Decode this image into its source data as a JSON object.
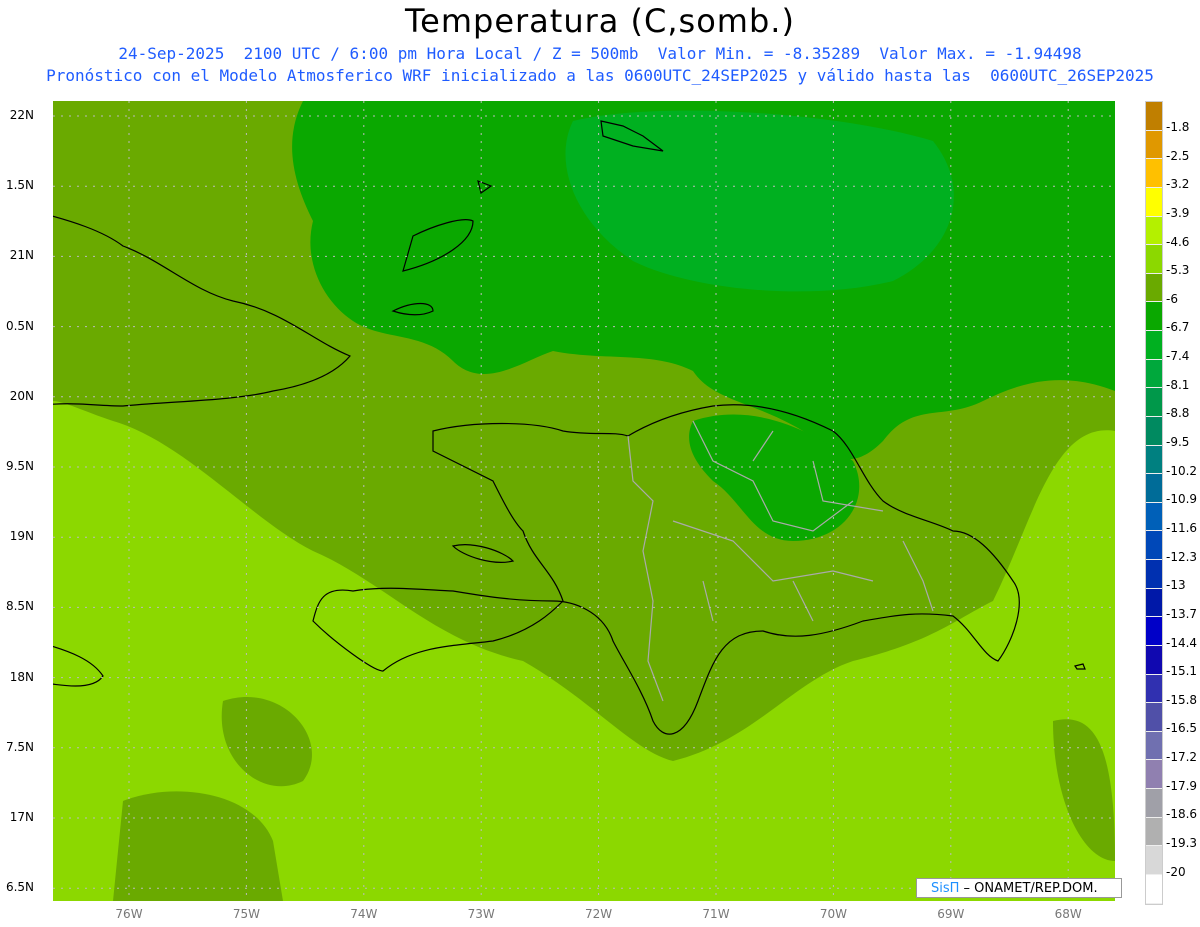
{
  "header": {
    "title": "Temperatura (C,somb.)",
    "line1": "24-Sep-2025  2100 UTC / 6:00 pm Hora Local / Z = 500mb  Valor Min. = -8.35289  Valor Max. = -1.94498",
    "line2": "Pronóstico con el Modelo Atmosferico WRF inicializado a las 0600UTC_24SEP2025 y válido hasta las  0600UTC_26SEP2025"
  },
  "axes": {
    "lat_labels": [
      "22N",
      "1.5N",
      "21N",
      "0.5N",
      "20N",
      "9.5N",
      "19N",
      "8.5N",
      "18N",
      "7.5N",
      "17N",
      "6.5N"
    ],
    "lon_labels": [
      "76W",
      "75W",
      "74W",
      "73W",
      "72W",
      "71W",
      "70W",
      "69W",
      "68W"
    ]
  },
  "colorbar": {
    "labels": [
      "-1.8",
      "-2.5",
      "-3.2",
      "-3.9",
      "-4.6",
      "-5.3",
      "-6",
      "-6.7",
      "-7.4",
      "-8.1",
      "-8.8",
      "-9.5",
      "-10.2",
      "-10.9",
      "-11.6",
      "-12.3",
      "-13",
      "-13.7",
      "-14.4",
      "-15.1",
      "-15.8",
      "-16.5",
      "-17.2",
      "-17.9",
      "-18.6",
      "-19.3",
      "-20"
    ],
    "colors": [
      "#c07f00",
      "#e09800",
      "#ffc000",
      "#ffff00",
      "#b4f000",
      "#8cd800",
      "#6aaa00",
      "#0aa800",
      "#00b020",
      "#00a83c",
      "#00984a",
      "#008a60",
      "#008080",
      "#006c98",
      "#0060b8",
      "#0048b8",
      "#0030b0",
      "#0018a8",
      "#0000c8",
      "#1008b0",
      "#3030b0",
      "#5050a8",
      "#7070b0",
      "#9080b0",
      "#a0a0a8",
      "#b0b0b0",
      "#d8d8d8",
      "#ffffff"
    ]
  },
  "credit": {
    "logo": "SisΠ",
    "text": " – ONAMET/REP.DOM."
  }
}
